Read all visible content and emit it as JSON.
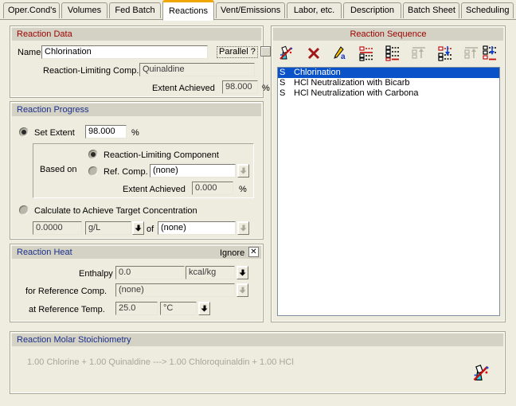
{
  "tabs": [
    {
      "label": "Oper.Cond's",
      "active": false
    },
    {
      "label": "Volumes",
      "active": false
    },
    {
      "label": "Fed Batch",
      "active": false
    },
    {
      "label": "Reactions",
      "active": true
    },
    {
      "label": "Vent/Emissions",
      "active": false
    },
    {
      "label": "Labor, etc.",
      "active": false
    },
    {
      "label": "Description",
      "active": false
    },
    {
      "label": "Batch Sheet",
      "active": false
    },
    {
      "label": "Scheduling",
      "active": false
    }
  ],
  "reaction_data": {
    "title": "Reaction Data",
    "title_color": "#9c0000",
    "name_label": "Name",
    "name_value": "Chlorination",
    "parallel_label": "Parallel ?",
    "parallel_checked": false,
    "limiting_comp_label": "Reaction-Limiting Comp.",
    "limiting_comp_value": "Quinaldine",
    "extent_achieved_label": "Extent Achieved",
    "extent_achieved_value": "98.000",
    "percent_unit": "%"
  },
  "reaction_progress": {
    "title": "Reaction Progress",
    "title_color": "#1b2f8c",
    "set_extent_label": "Set Extent",
    "set_extent_selected": true,
    "set_extent_value": "98.000",
    "percent_unit": "%",
    "based_on_label": "Based on",
    "limiting_component_label": "Reaction-Limiting Component",
    "limiting_component_selected": true,
    "ref_comp_label": "Ref. Comp.",
    "ref_comp_selected": false,
    "ref_comp_value": "(none)",
    "extent_achieved_label": "Extent Achieved",
    "extent_achieved_value": "0.000",
    "calculate_label": "Calculate to Achieve Target Concentration",
    "calculate_selected": false,
    "target_value": "0.0000",
    "target_units": "g/L",
    "of_label": "of",
    "target_component": "(none)"
  },
  "reaction_heat": {
    "title": "Reaction Heat",
    "title_color": "#1b2f8c",
    "ignore_label": "Ignore",
    "ignore_checked": true,
    "enthalpy_label": "Enthalpy",
    "enthalpy_value": "0.0",
    "enthalpy_units": "kcal/kg",
    "ref_comp_label": "for Reference Comp.",
    "ref_comp_value": "(none)",
    "ref_temp_label": "at Reference Temp.",
    "ref_temp_value": "25.0",
    "ref_temp_units": "°C"
  },
  "reaction_sequence": {
    "title": "Reaction Sequence",
    "title_color": "#9c0000",
    "toolbar": [
      {
        "name": "new-reaction-icon",
        "enabled": true
      },
      {
        "name": "delete-reaction-icon",
        "enabled": true
      },
      {
        "name": "rename-reaction-icon",
        "enabled": true
      },
      {
        "name": "move-to-top-icon",
        "enabled": true
      },
      {
        "name": "move-to-bottom-icon",
        "enabled": true
      },
      {
        "name": "insert-above-icon",
        "enabled": false
      },
      {
        "name": "move-up-icon",
        "enabled": true
      },
      {
        "name": "insert-below-icon",
        "enabled": false
      },
      {
        "name": "move-down-icon",
        "enabled": true
      }
    ],
    "items": [
      {
        "prefix": "S",
        "label": "Chlorination",
        "selected": true
      },
      {
        "prefix": "S",
        "label": "HCl Neutralization with Bicarb",
        "selected": false
      },
      {
        "prefix": "S",
        "label": "HCl Neutralization with Carbona",
        "selected": false
      }
    ]
  },
  "stoichiometry": {
    "title": "Reaction Molar Stoichiometry",
    "title_color": "#1b2f8c",
    "equation": "1.00 Chlorine + 1.00 Quinaldine  --->   1.00 Chloroquinaldin + 1.00 HCl",
    "flask_icon": "flask-icon"
  }
}
